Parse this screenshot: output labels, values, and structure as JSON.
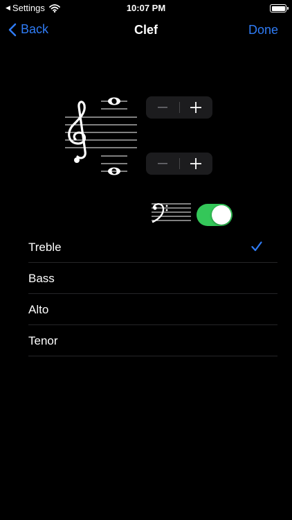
{
  "status_bar": {
    "back_app": "Settings",
    "time": "10:07 PM"
  },
  "nav": {
    "back_label": "Back",
    "title": "Clef",
    "done_label": "Done"
  },
  "steppers": {
    "upper": {
      "minus": "−",
      "plus": "+"
    },
    "lower": {
      "minus": "−",
      "plus": "+"
    }
  },
  "bass_toggle": {
    "on": true
  },
  "clefs": {
    "selected": "Treble",
    "items": [
      "Treble",
      "Bass",
      "Alto",
      "Tenor"
    ]
  },
  "colors": {
    "accent": "#2f7cf6",
    "toggle_on": "#34c759",
    "control_bg": "#1c1c1e",
    "separator": "#262628"
  }
}
